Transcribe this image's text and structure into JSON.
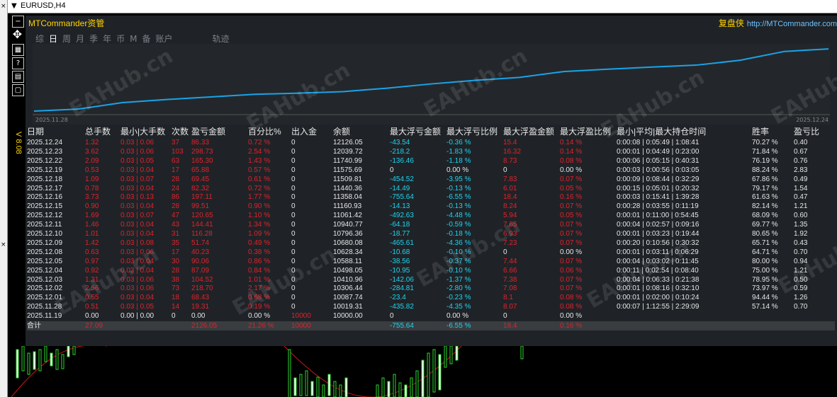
{
  "window": {
    "title": "EURUSD,H4"
  },
  "side_label": "V 8.08",
  "brand": {
    "left": "MTCommander资管",
    "right_zh": "复盘侠",
    "right_url": "http://MTCommander.com"
  },
  "tabs": [
    "综",
    "日",
    "周",
    "月",
    "季",
    "年",
    "币",
    "M",
    "备",
    "账户",
    "轨迹"
  ],
  "active_tab": 1,
  "watermark": "EAHub.cn",
  "equity_chart": {
    "start_date": "2025.11.28",
    "end_date": "2025.12.24",
    "line_color": "#1aa3e8"
  },
  "chart_data": {
    "type": "line",
    "x": [
      "2025.11.28",
      "2025.12.01",
      "2025.12.02",
      "2025.12.03",
      "2025.12.04",
      "2025.12.05",
      "2025.12.08",
      "2025.12.09",
      "2025.12.10",
      "2025.12.11",
      "2025.12.12",
      "2025.12.15",
      "2025.12.16",
      "2025.12.17",
      "2025.12.18",
      "2025.12.19",
      "2025.12.22",
      "2025.12.23",
      "2025.12.24"
    ],
    "values": [
      10019.31,
      10087.74,
      10306.44,
      10410.96,
      10498.05,
      10588.11,
      10628.34,
      10680.08,
      10796.36,
      10940.77,
      11061.42,
      11160.93,
      11358.04,
      11440.36,
      11509.81,
      11575.69,
      11740.99,
      12039.72,
      12126.05
    ],
    "xlabel": "",
    "ylabel": "",
    "ylim": [
      9900,
      12200
    ]
  },
  "table": {
    "headers": [
      "日期",
      "总手数",
      "最小|大手数",
      "次数",
      "盈亏金额",
      "百分比%",
      "出入金",
      "余额",
      "最大浮亏金额",
      "最大浮亏比例",
      "最大浮盈金额",
      "最大浮盈比例",
      "最小|平均|最大持仓时间",
      "胜率",
      "盈亏比"
    ],
    "rows": [
      [
        "2025.12.24",
        "1.32",
        "0.03 | 0.06",
        "37",
        "86.33",
        "0.72 %",
        "0",
        "12126.05",
        "-43.54",
        "-0.36 %",
        "15.4",
        "0.14 %",
        "0:00:08 | 0:05:49 | 1:08:41",
        "70.27 %",
        "0.40"
      ],
      [
        "2025.12.23",
        "3.62",
        "0.03 | 0.06",
        "103",
        "298.73",
        "2.54 %",
        "0",
        "12039.72",
        "-218.2",
        "-1.83 %",
        "16.32",
        "0.14 %",
        "0:00:01 | 0:04:49 | 0:23:00",
        "71.84 %",
        "0.67"
      ],
      [
        "2025.12.22",
        "2.09",
        "0.03 | 0.05",
        "63",
        "165.30",
        "1.43 %",
        "0",
        "11740.99",
        "-136.46",
        "-1.18 %",
        "8.73",
        "0.08 %",
        "0:00:06 | 0:05:15 | 0:40:31",
        "76.19 %",
        "0.76"
      ],
      [
        "2025.12.19",
        "0.53",
        "0.03 | 0.04",
        "17",
        "65.88",
        "0.57 %",
        "0",
        "11575.69",
        "0",
        "0.00 %",
        "0",
        "0.00 %",
        "0:00:03 | 0:00:56 | 0:03:05",
        "88.24 %",
        "2.83"
      ],
      [
        "2025.12.18",
        "1.09",
        "0.03 | 0.07",
        "28",
        "69.45",
        "0.61 %",
        "0",
        "11509.81",
        "-454.52",
        "-3.95 %",
        "7.83",
        "0.07 %",
        "0:00:09 | 0:08:44 | 0:32:29",
        "67.86 %",
        "0.49"
      ],
      [
        "2025.12.17",
        "0.78",
        "0.03 | 0.04",
        "24",
        "82.32",
        "0.72 %",
        "0",
        "11440.36",
        "-14.49",
        "-0.13 %",
        "6.01",
        "0.05 %",
        "0:00:15 | 0:05:01 | 0:20:32",
        "79.17 %",
        "1.54"
      ],
      [
        "2025.12.16",
        "3.73",
        "0.03 | 0.13",
        "86",
        "197.11",
        "1.77 %",
        "0",
        "11358.04",
        "-755.64",
        "-6.55 %",
        "18.4",
        "0.16 %",
        "0:00:03 | 0:15:41 | 1:39:28",
        "61.63 %",
        "0.47"
      ],
      [
        "2025.12.15",
        "0.90",
        "0.03 | 0.04",
        "28",
        "99.51",
        "0.90 %",
        "0",
        "11160.93",
        "-14.13",
        "-0.13 %",
        "8.24",
        "0.07 %",
        "0:00:28 | 0:03:55 | 0:11:19",
        "82.14 %",
        "1.21"
      ],
      [
        "2025.12.12",
        "1.69",
        "0.03 | 0.07",
        "47",
        "120.65",
        "1.10 %",
        "0",
        "11061.42",
        "-492.63",
        "-4.48 %",
        "5.94",
        "0.05 %",
        "0:00:01 | 0:11:00 | 0:54:45",
        "68.09 %",
        "0.60"
      ],
      [
        "2025.12.11",
        "1.46",
        "0.03 | 0.04",
        "43",
        "144.41",
        "1.34 %",
        "0",
        "10940.77",
        "-64.18",
        "-0.59 %",
        "7.65",
        "0.07 %",
        "0:00:04 | 0:02:57 | 0:09:16",
        "69.77 %",
        "1.35"
      ],
      [
        "2025.12.10",
        "1.01",
        "0.03 | 0.04",
        "31",
        "116.28",
        "1.09 %",
        "0",
        "10796.36",
        "-18.77",
        "-0.18 %",
        "6.93",
        "0.07 %",
        "0:00:01 | 0:03:23 | 0:19:44",
        "80.65 %",
        "1.92"
      ],
      [
        "2025.12.09",
        "1.42",
        "0.03 | 0.08",
        "35",
        "51.74",
        "0.49 %",
        "0",
        "10680.08",
        "-465.61",
        "-4.36 %",
        "7.23",
        "0.07 %",
        "0:00:20 | 0:10:56 | 0:30:32",
        "65.71 %",
        "0.43"
      ],
      [
        "2025.12.08",
        "0.63",
        "0.03 | 0.06",
        "17",
        "40.23",
        "0.38 %",
        "0",
        "10628.34",
        "-10.68",
        "-0.10 %",
        "0",
        "0.00 %",
        "0:00:01 | 0:03:11 | 0:06:29",
        "64.71 %",
        "0.70"
      ],
      [
        "2025.12.05",
        "0.97",
        "0.03 | 0.04",
        "30",
        "90.06",
        "0.86 %",
        "0",
        "10588.11",
        "-38.56",
        "-0.37 %",
        "7.44",
        "0.07 %",
        "0:00:04 | 0:03:02 | 0:11:45",
        "80.00 %",
        "0.94"
      ],
      [
        "2025.12.04",
        "0.92",
        "0.03 | 0.04",
        "28",
        "87.09",
        "0.84 %",
        "0",
        "10498.05",
        "-10.95",
        "-0.10 %",
        "6.66",
        "0.06 %",
        "0:00:11 | 0:02:54 | 0:08:40",
        "75.00 %",
        "1.21"
      ],
      [
        "2025.12.03",
        "1.31",
        "0.03 | 0.06",
        "38",
        "104.52",
        "1.01 %",
        "0",
        "10410.96",
        "-142.06",
        "-1.37 %",
        "7.38",
        "0.07 %",
        "0:00:04 | 0:06:33 | 0:21:38",
        "78.95 %",
        "0.50"
      ],
      [
        "2025.12.02",
        "2.56",
        "0.03 | 0.06",
        "73",
        "218.70",
        "2.17 %",
        "0",
        "10306.44",
        "-284.81",
        "-2.80 %",
        "7.08",
        "0.07 %",
        "0:00:01 | 0:08:16 | 0:32:10",
        "73.97 %",
        "0.59"
      ],
      [
        "2025.12.01",
        "0.55",
        "0.03 | 0.04",
        "18",
        "68.43",
        "0.68 %",
        "0",
        "10087.74",
        "-23.4",
        "-0.23 %",
        "8.1",
        "0.08 %",
        "0:00:01 | 0:02:00 | 0:10:24",
        "94.44 %",
        "1.26"
      ],
      [
        "2025.11.28",
        "0.51",
        "0.03 | 0.05",
        "14",
        "19.31",
        "0.19 %",
        "0",
        "10019.31",
        "-435.82",
        "-4.35 %",
        "8.07",
        "0.08 %",
        "0:00:07 | 1:12:55 | 2:29:09",
        "57.14 %",
        "0.70"
      ],
      [
        "2025.11.19",
        "0.00",
        "0.00 | 0.00",
        "0",
        "0.00",
        "0.00 %",
        "10000",
        "10000.00",
        "0",
        "0.00 %",
        "0",
        "0.00 %",
        "",
        "",
        ""
      ]
    ],
    "total": [
      "合计",
      "27.09",
      "",
      "",
      "2126.05",
      "21.26 %",
      "10000",
      "",
      "-755.64",
      "-6.55 %",
      "18.4",
      "0.16 %",
      "",
      "",
      ""
    ]
  },
  "colors": {
    "panel_bg": "#1f2327",
    "positive": "#e0222b",
    "negative": "#1fd3f0",
    "brand": "#ffd400"
  }
}
